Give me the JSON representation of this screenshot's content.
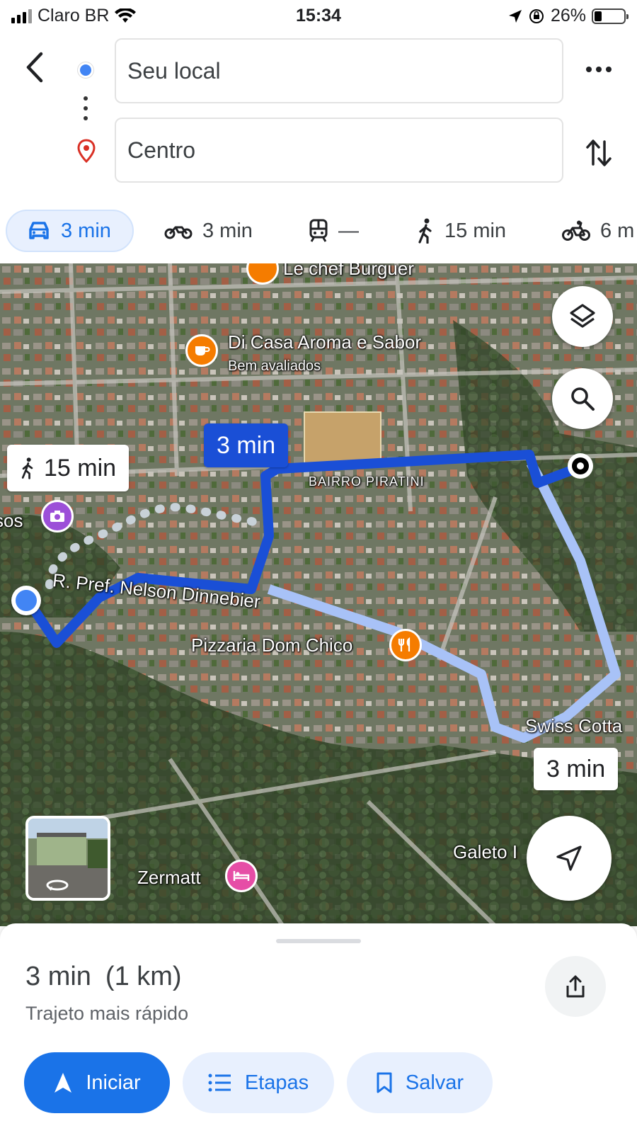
{
  "status_bar": {
    "carrier": "Claro BR",
    "time": "15:34",
    "battery": "26%",
    "battery_level": 0.26
  },
  "directions": {
    "origin_value": "Seu local",
    "destination_value": "Centro"
  },
  "modes": [
    {
      "icon": "car-icon",
      "label": "3 min",
      "active": true
    },
    {
      "icon": "motorcycle-icon",
      "label": "3 min",
      "active": false
    },
    {
      "icon": "transit-icon",
      "label": "—",
      "active": false
    },
    {
      "icon": "walk-icon",
      "label": "15 min",
      "active": false
    },
    {
      "icon": "bike-icon",
      "label": "6 m",
      "active": false
    }
  ],
  "map": {
    "labels": {
      "poi_burger": "Le chef Burguer",
      "poi_cafe": "Di Casa Aroma e Sabor",
      "poi_cafe_note": "Bem avaliados",
      "neighborhood": "BAIRRO PIRATINI",
      "street": "R. Pref. Nelson Dinnebier",
      "poi_pizza": "Pizzaria Dom Chico",
      "poi_swiss": "Swiss Cotta",
      "poi_galeto": "Galeto I",
      "poi_hotel": "Zermatt",
      "poi_partial": "sos"
    },
    "route_bubbles": {
      "main": "3 min",
      "walk": "15 min",
      "alt": "3 min"
    },
    "route_colors": {
      "primary": "#1a4fd6",
      "alternate": "#a8c2f7",
      "walking": "#b8c4cc"
    }
  },
  "sheet": {
    "duration": "3 min",
    "distance": "(1 km)",
    "subtitle": "Trajeto mais rápido",
    "start_label": "Iniciar",
    "steps_label": "Etapas",
    "save_label": "Salvar"
  }
}
